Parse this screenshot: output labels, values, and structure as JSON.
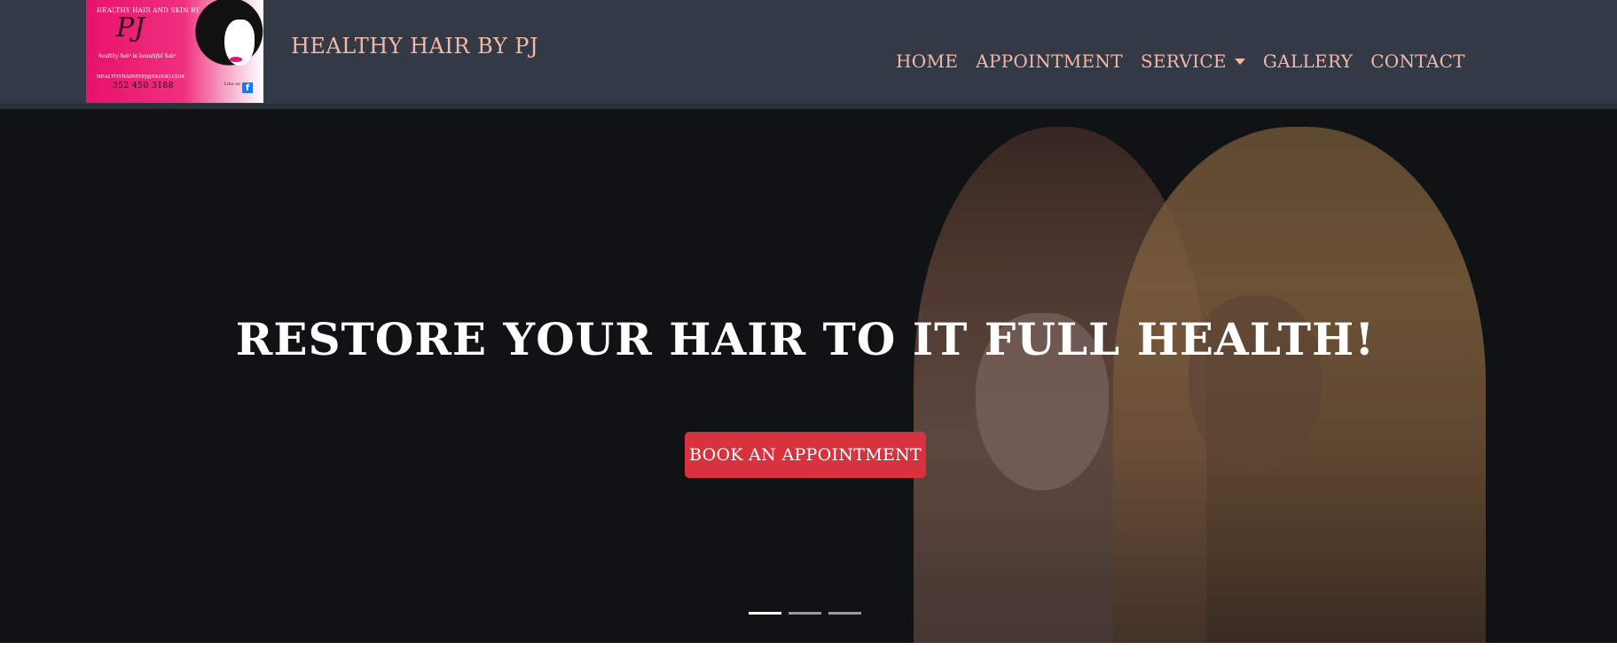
{
  "brand": {
    "name": "HEALTHY HAIR BY PJ",
    "logo": {
      "top_text": "HEALTHY HAIR AND SKIN BY",
      "monogram": "PJ",
      "tagline": "healthy hair is beautiful hair",
      "email": "HEALTHYHAIRBYPJ@YAHOO.COM",
      "phone": "352 450 3188",
      "like_text": "Like us",
      "facebook_icon": "f"
    }
  },
  "nav": {
    "items": [
      {
        "label": "HOME"
      },
      {
        "label": "APPOINTMENT"
      },
      {
        "label": "SERVICE",
        "dropdown": true
      },
      {
        "label": "GALLERY"
      },
      {
        "label": "CONTACT"
      }
    ]
  },
  "hero": {
    "title": "RESTORE YOUR HAIR TO IT FULL HEALTH!",
    "cta_label": "BOOK AN APPOINTMENT",
    "slides_total": 3,
    "active_slide": 1
  },
  "colors": {
    "navbar_bg": "#343a45",
    "nav_text": "#f2b8a8",
    "cta_bg": "#d9323f",
    "hero_bg": "#111213"
  }
}
